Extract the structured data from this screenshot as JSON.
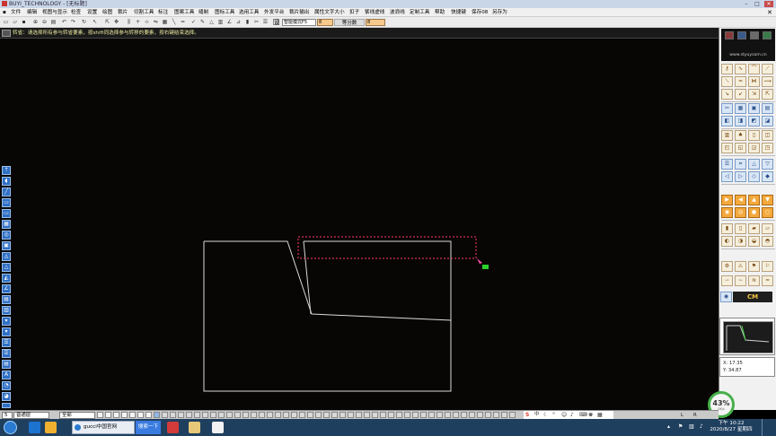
{
  "title_bar": {
    "title": "BUYI_TECHNOLOGY - [无标题]",
    "minimize": "–",
    "maximize": "□",
    "close": "✕"
  },
  "menu": {
    "items": [
      "文件",
      "编辑",
      "视图与显示",
      "检查",
      "设置",
      "绘图",
      "裁片",
      "切割工具",
      "标注",
      "图案工具",
      "缝制",
      "图标工具",
      "选用工具",
      "外发平台",
      "裁片输出",
      "属性文字大小",
      "扣子",
      "紫线虚线",
      "波浪线",
      "定制工具",
      "帮助",
      "快捷键",
      "保存08",
      "另存为"
    ],
    "close": "✕"
  },
  "toolbar": {
    "mode_select": "智能模式F5",
    "field_value": "8",
    "segment_label": "等分数",
    "segment_value": "8",
    "text_tool": "设"
  },
  "prompt": {
    "text": "转省：请选择所有参与转省要素，按shift同选择参与转移的要素，按右键结束选择。"
  },
  "canvas": {
    "background": "#080604",
    "stroke": "#d9d9d9",
    "selection_color": "#ff3b6b"
  },
  "left_tools": [
    "⇡",
    "◖",
    "╱",
    "▭",
    "▭",
    "▦",
    "◎",
    "▣",
    "◬",
    "△",
    "◭",
    "∠",
    "▤",
    "▥",
    "▾",
    "▾",
    "☰",
    "☰",
    "▤",
    "A",
    "◔",
    "◕",
    "◐"
  ],
  "right_panel": {
    "site": "www.styuysam.cn",
    "cm_label": "CM",
    "coord_x": "X: 17.35",
    "coord_y": "Y: 34.87"
  },
  "zoom_badge": {
    "percent": "43%",
    "sub": "0K/s"
  },
  "layer_bar": {
    "layer_value": "5",
    "layer_name": "普通层",
    "scope_value": "全部",
    "hint_l": "L",
    "hint_r": "R"
  },
  "taskbar": {
    "browser_tab": "gucci中国官网",
    "search_button": "搜索一下",
    "time": "下午 10:22",
    "date": "2020/8/27 星期四"
  }
}
